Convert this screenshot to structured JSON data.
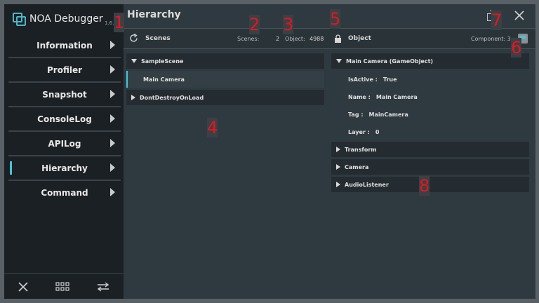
{
  "app": {
    "title": "NOA Debugger",
    "version": "1.6.0"
  },
  "sidebar": {
    "items": [
      {
        "label": "Information"
      },
      {
        "label": "Profiler"
      },
      {
        "label": "Snapshot"
      },
      {
        "label": "ConsoleLog"
      },
      {
        "label": "APILog"
      },
      {
        "label": "Hierarchy",
        "active": true
      },
      {
        "label": "Command"
      }
    ],
    "bottom_icons": [
      "close-icon",
      "grid-icon",
      "swap-icon"
    ]
  },
  "main": {
    "title": "Hierarchy",
    "toolbar": {
      "scenes_label": "Scenes",
      "scenes_count_label": "Scenes:",
      "scenes_count": "2",
      "object_count_label": "Object:",
      "object_count": "4988",
      "object_label": "Object",
      "component_label": "Component: 3"
    },
    "hierarchy": {
      "scene1": "SampleScene",
      "scene1_child": "Main Camera",
      "scene2": "DontDestroyOnLoad"
    },
    "inspector": {
      "header": "Main Camera (GameObject)",
      "props": [
        {
          "key": "IsActive :",
          "value": "True"
        },
        {
          "key": "Name :",
          "value": "Main Camera"
        },
        {
          "key": "Tag :",
          "value": "MainCamera"
        },
        {
          "key": "Layer :",
          "value": "0"
        }
      ],
      "components": [
        "Transform",
        "Camera",
        "AudioListener"
      ]
    }
  },
  "markers": [
    "1",
    "2",
    "3",
    "4",
    "5",
    "6",
    "7",
    "8"
  ],
  "colors": {
    "accent": "#47c4d8",
    "marker": "#e8141c"
  }
}
